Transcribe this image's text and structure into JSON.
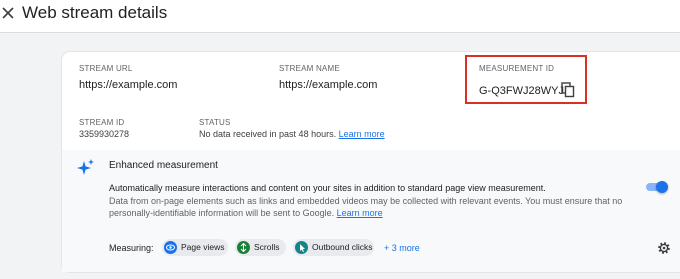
{
  "header": {
    "title": "Web stream details"
  },
  "stream": {
    "url_label": "STREAM URL",
    "url_value": "https://example.com",
    "name_label": "STREAM NAME",
    "name_value": "https://example.com",
    "measurement_id_label": "MEASUREMENT ID",
    "measurement_id_value": "G-Q3FWJ28WYJ",
    "id_label": "STREAM ID",
    "id_value": "3359930278",
    "status_label": "STATUS",
    "status_value": "No data received in past 48 hours.",
    "status_link": "Learn more"
  },
  "enhanced": {
    "title": "Enhanced measurement",
    "description": "Automatically measure interactions and content on your sites in addition to standard page view measurement.",
    "note": "Data from on-page elements such as links and embedded videos may be collected with relevant events. You must ensure that no personally-identifiable information will be sent to Google.",
    "note_link": "Learn more",
    "toggle_on": true,
    "measuring_label": "Measuring:",
    "chips": [
      {
        "label": "Page views",
        "icon": "eye-icon",
        "color": "#1a73e8"
      },
      {
        "label": "Scrolls",
        "icon": "scroll-icon",
        "color": "#188038"
      },
      {
        "label": "Outbound clicks",
        "icon": "cursor-icon",
        "color": "#12858a"
      }
    ],
    "more": "+ 3 more"
  },
  "colors": {
    "accent": "#1a73e8",
    "highlight": "#d93025"
  }
}
